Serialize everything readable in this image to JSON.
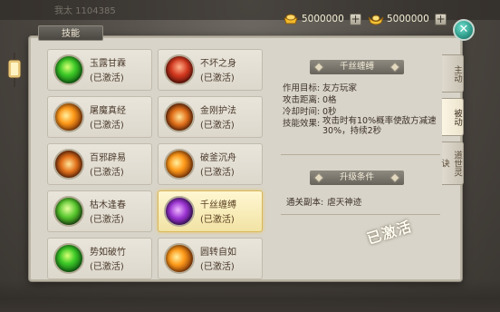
{
  "background": {
    "faded_text": "我太 1104385"
  },
  "currency": {
    "gold": {
      "icon": "gold-ingot-icon",
      "value": "5000000",
      "add_label": "+"
    },
    "ingot": {
      "icon": "yuanbao-icon",
      "value": "5000000",
      "add_label": "+"
    }
  },
  "panel": {
    "title": "技能",
    "close_label": "✕"
  },
  "skills": [
    {
      "name": "玉露甘霖",
      "status": "(已激活)",
      "icon": "green-orb-icon"
    },
    {
      "name": "不坏之身",
      "status": "(已激活)",
      "icon": "red-figure-icon"
    },
    {
      "name": "屠魔真经",
      "status": "(已激活)",
      "icon": "fire-slash-icon"
    },
    {
      "name": "金刚护法",
      "status": "(已激活)",
      "icon": "amber-guardian-icon"
    },
    {
      "name": "百邪辟易",
      "status": "(已激活)",
      "icon": "fire-ring-icon"
    },
    {
      "name": "破釜沉舟",
      "status": "(已激活)",
      "icon": "flame-wave-icon"
    },
    {
      "name": "枯木逢春",
      "status": "(已激活)",
      "icon": "green-tree-icon"
    },
    {
      "name": "千丝缠缚",
      "status": "(已激活)",
      "icon": "purple-vortex-icon"
    },
    {
      "name": "势如破竹",
      "status": "(已激活)",
      "icon": "green-burst-icon"
    },
    {
      "name": "圆转自如",
      "status": "(已激活)",
      "icon": "amber-spin-icon"
    }
  ],
  "detail": {
    "title": "千丝缠缚",
    "target_label": "作用目标:",
    "target_value": "友方玩家",
    "range_label": "攻击距离:",
    "range_value": "0格",
    "cooldown_label": "冷却时间:",
    "cooldown_value": "0秒",
    "effect_label": "技能效果:",
    "effect_value": "攻击时有10%概率使敌方减速30%，持续2秒",
    "upgrade_title": "升级条件",
    "requirement_label": "通关副本:",
    "requirement_value": "虐天神迹",
    "stamp": "已激活"
  },
  "tabs": [
    {
      "label": "主动"
    },
    {
      "label": "被动"
    },
    {
      "label": "道世灵诀"
    }
  ],
  "colors": {
    "selected_border": "#d8b75a",
    "panel_bg": "#d8d4c9",
    "close_button": "#2f9a89"
  }
}
